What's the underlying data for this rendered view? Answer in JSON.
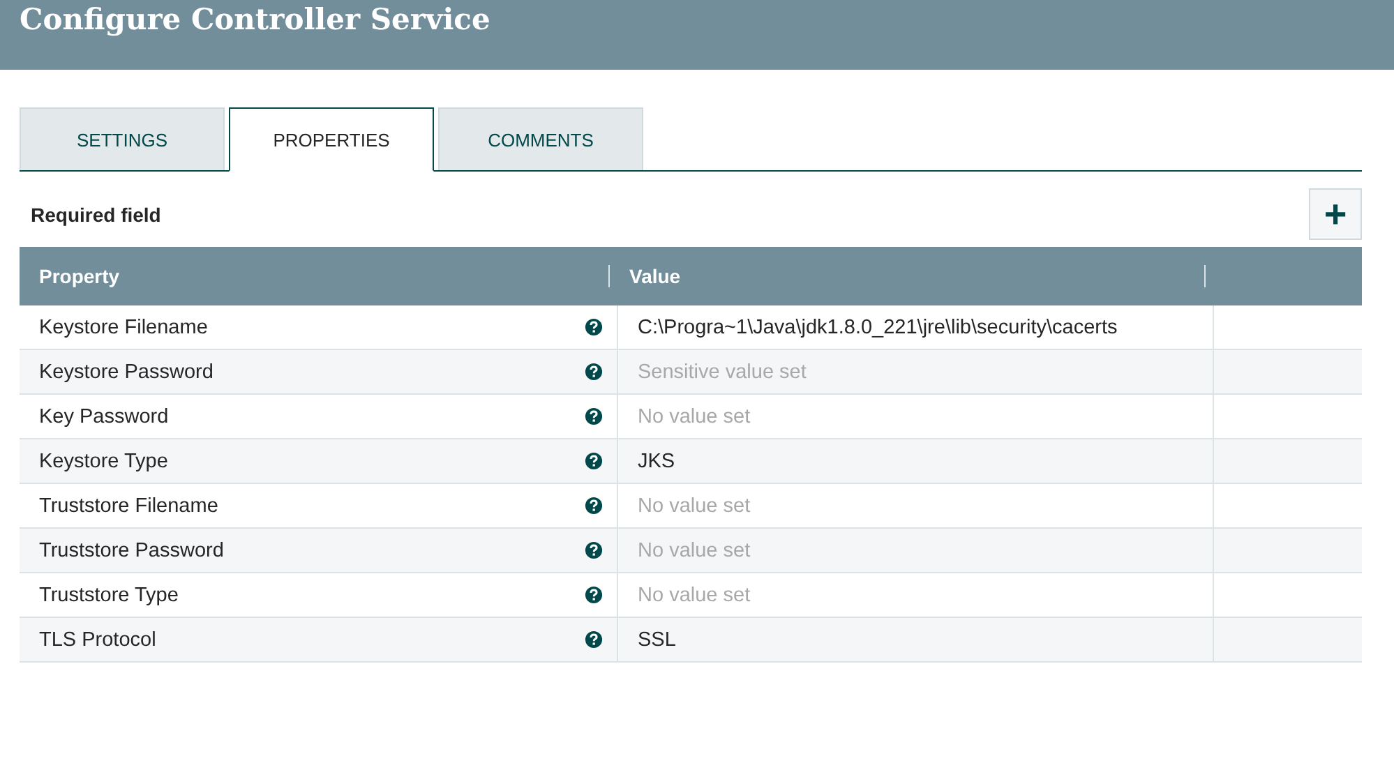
{
  "header": {
    "title": "Configure Controller Service"
  },
  "tabs": [
    {
      "label": "SETTINGS",
      "selected": false
    },
    {
      "label": "PROPERTIES",
      "selected": true
    },
    {
      "label": "COMMENTS",
      "selected": false
    }
  ],
  "required_label": "Required field",
  "add_button": {
    "label": "+"
  },
  "table": {
    "columns": [
      "Property",
      "Value"
    ],
    "rows": [
      {
        "property": "Keystore Filename",
        "value": "C:\\Progra~1\\Java\\jdk1.8.0_221\\jre\\lib\\security\\cacerts",
        "muted": false
      },
      {
        "property": "Keystore Password",
        "value": "Sensitive value set",
        "muted": true
      },
      {
        "property": "Key Password",
        "value": "No value set",
        "muted": true
      },
      {
        "property": "Keystore Type",
        "value": "JKS",
        "muted": false
      },
      {
        "property": "Truststore Filename",
        "value": "No value set",
        "muted": true
      },
      {
        "property": "Truststore Password",
        "value": "No value set",
        "muted": true
      },
      {
        "property": "Truststore Type",
        "value": "No value set",
        "muted": true
      },
      {
        "property": "TLS Protocol",
        "value": "SSL",
        "muted": false
      }
    ]
  }
}
